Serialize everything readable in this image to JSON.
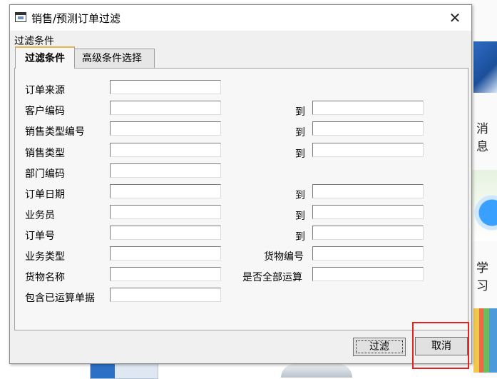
{
  "dialog": {
    "title": "销售/预测订单过滤",
    "close_glyph": "✕",
    "group_label": "过滤条件"
  },
  "tabs": [
    {
      "label": "过滤条件",
      "active": true
    },
    {
      "label": "高级条件选择",
      "active": false
    }
  ],
  "fields": [
    {
      "label": "订单来源",
      "value": "",
      "to_label": "",
      "to_value": null
    },
    {
      "label": "客户编码",
      "value": "",
      "to_label": "到",
      "to_value": ""
    },
    {
      "label": "销售类型编号",
      "value": "",
      "to_label": "到",
      "to_value": ""
    },
    {
      "label": "销售类型",
      "value": "",
      "to_label": "到",
      "to_value": ""
    },
    {
      "label": "部门编码",
      "value": "",
      "to_label": "",
      "to_value": null
    },
    {
      "label": "订单日期",
      "value": "",
      "to_label": "到",
      "to_value": ""
    },
    {
      "label": "业务员",
      "value": "",
      "to_label": "到",
      "to_value": ""
    },
    {
      "label": "订单号",
      "value": "",
      "to_label": "到",
      "to_value": ""
    },
    {
      "label": "业务类型",
      "value": "",
      "to_label": "货物编号",
      "to_value": ""
    },
    {
      "label": "货物名称",
      "value": "",
      "to_label": "是否全部运算",
      "to_value": ""
    },
    {
      "label": "包含已运算单据",
      "value": "",
      "to_label": "",
      "to_value": null
    }
  ],
  "buttons": {
    "filter": "过滤",
    "cancel": "取消"
  },
  "background": {
    "text_1": "消息",
    "text_2": "学习"
  },
  "colors": {
    "highlight": "#e8201e",
    "active_tab_accent": "#e8b64a"
  }
}
